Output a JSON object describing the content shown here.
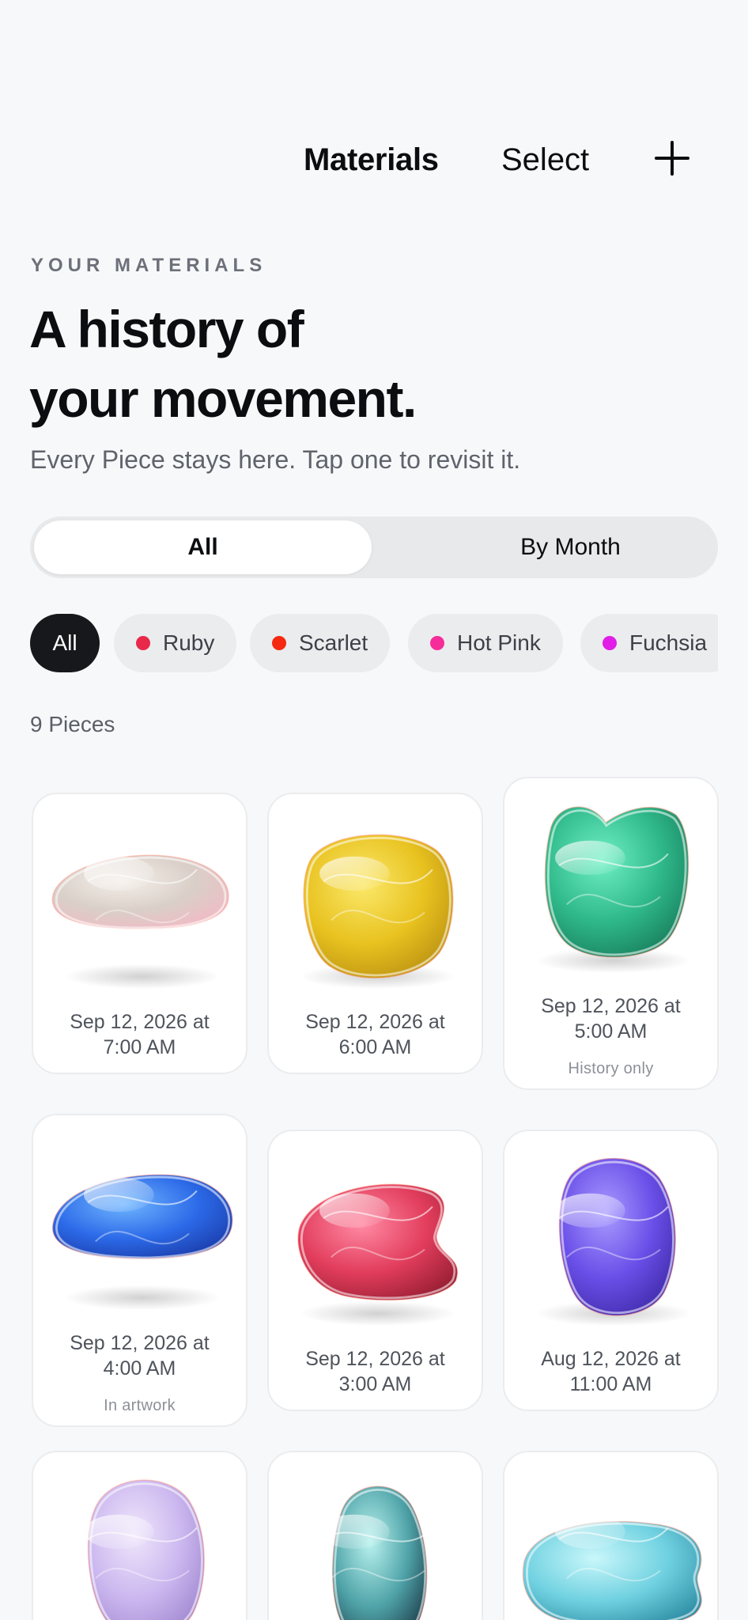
{
  "nav": {
    "title": "Materials",
    "select_label": "Select",
    "add_icon": "plus-icon"
  },
  "header": {
    "eyebrow": "YOUR MATERIALS",
    "headline_line1": "A history of",
    "headline_line2": "your movement.",
    "subtitle": "Every Piece stays here. Tap one to revisit it."
  },
  "segment": {
    "options": [
      "All",
      "By Month"
    ],
    "selected": "All"
  },
  "filters": [
    {
      "label": "All",
      "color": null,
      "active": true
    },
    {
      "label": "Ruby",
      "color": "#e8294a",
      "active": false
    },
    {
      "label": "Scarlet",
      "color": "#f5290f",
      "active": false
    },
    {
      "label": "Hot Pink",
      "color": "#f52c9a",
      "active": false
    },
    {
      "label": "Fuchsia",
      "color": "#e21de8",
      "active": false
    }
  ],
  "count_label": "9 Pieces",
  "pieces": [
    {
      "date_line1": "Sep 12, 2026 at",
      "date_line2": "7:00 AM",
      "status": "",
      "colors": [
        "#f4efe9",
        "#d9cfc8",
        "#f2b9c4"
      ]
    },
    {
      "date_line1": "Sep 12, 2026 at",
      "date_line2": "6:00 AM",
      "status": "",
      "colors": [
        "#fbe86a",
        "#e8c21f",
        "#b98f12"
      ]
    },
    {
      "date_line1": "Sep 12, 2026 at",
      "date_line2": "5:00 AM",
      "status": "History only",
      "colors": [
        "#6ff0c4",
        "#2fb98a",
        "#177a5a"
      ]
    },
    {
      "date_line1": "Sep 12, 2026 at",
      "date_line2": "4:00 AM",
      "status": "In artwork",
      "colors": [
        "#6fb6ff",
        "#2c6ae8",
        "#1a3aa8"
      ]
    },
    {
      "date_line1": "Sep 12, 2026 at",
      "date_line2": "3:00 AM",
      "status": "",
      "colors": [
        "#ff8aa4",
        "#e23d5c",
        "#9a1f34"
      ]
    },
    {
      "date_line1": "Aug 12, 2026 at",
      "date_line2": "11:00 AM",
      "status": "",
      "colors": [
        "#a99bff",
        "#6a4fe8",
        "#3f2aa8"
      ]
    },
    {
      "date_line1": "",
      "date_line2": "",
      "status": "",
      "colors": [
        "#efe6fb",
        "#cbb7ef",
        "#9f86cf"
      ]
    },
    {
      "date_line1": "",
      "date_line2": "",
      "status": "",
      "colors": [
        "#b9f2ef",
        "#4fa3a8",
        "#1d3c4a"
      ]
    },
    {
      "date_line1": "",
      "date_line2": "",
      "status": "",
      "colors": [
        "#c9f7fb",
        "#6fd1e0",
        "#2f8fa6"
      ]
    }
  ]
}
